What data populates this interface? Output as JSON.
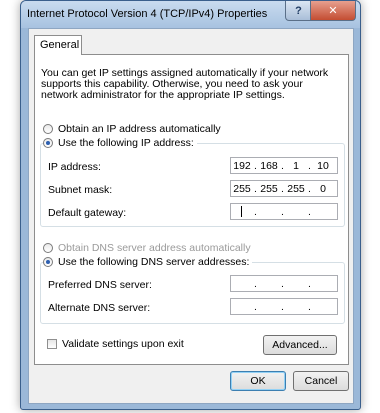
{
  "window": {
    "title": "Internet Protocol Version 4 (TCP/IPv4) Properties",
    "help_glyph": "?",
    "close_glyph": "✕"
  },
  "tab": {
    "label": "General"
  },
  "intro_text": "You can get IP settings assigned automatically if your network supports this capability. Otherwise, you need to ask your network administrator for the appropriate IP settings.",
  "ip_section": {
    "auto_label": "Obtain an IP address automatically",
    "manual_label": "Use the following IP address:",
    "selected": "manual",
    "fields": [
      {
        "label": "IP address:",
        "octets": [
          "192",
          "168",
          "1",
          "10"
        ]
      },
      {
        "label": "Subnet mask:",
        "octets": [
          "255",
          "255",
          "255",
          "0"
        ]
      },
      {
        "label": "Default gateway:",
        "octets": [
          "",
          "",
          "",
          ""
        ]
      }
    ]
  },
  "dns_section": {
    "auto_label": "Obtain DNS server address automatically",
    "manual_label": "Use the following DNS server addresses:",
    "selected": "manual",
    "fields": [
      {
        "label": "Preferred DNS server:",
        "octets": [
          "",
          "",
          "",
          ""
        ]
      },
      {
        "label": "Alternate DNS server:",
        "octets": [
          "",
          "",
          "",
          ""
        ]
      }
    ]
  },
  "validate_label": "Validate settings upon exit",
  "validate_checked": false,
  "buttons": {
    "advanced": "Advanced...",
    "ok": "OK",
    "cancel": "Cancel"
  },
  "dot": "."
}
